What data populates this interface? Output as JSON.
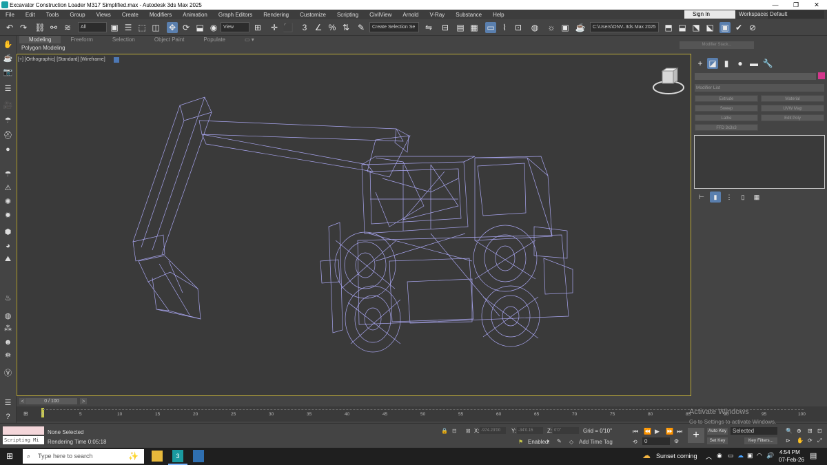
{
  "window": {
    "title": "Excavator Construction Loader M317 Simplified.max - Autodesk 3ds Max 2025",
    "min": "—",
    "max": "❐",
    "close": "✕"
  },
  "menus": [
    "File",
    "Edit",
    "Tools",
    "Group",
    "Views",
    "Create",
    "Modifiers",
    "Animation",
    "Graph Editors",
    "Rendering",
    "Customize",
    "Scripting",
    "CivilView",
    "Arnold",
    "V-Ray",
    "Substance",
    "Help"
  ],
  "account": {
    "signin": "Sign In",
    "workspaces_label": "Workspaces:",
    "workspace": "Default"
  },
  "toolbar": {
    "selection_filter": "All",
    "ref_coord": "View",
    "named_selection": "Create Selection Se",
    "project_path": "C:\\Users\\ONV..3ds Max 2025"
  },
  "ribbon": {
    "tabs": [
      "Modeling",
      "Freeform",
      "Selection",
      "Object Paint",
      "Populate"
    ],
    "active_tab": "Modeling",
    "panel_label": "Polygon Modeling"
  },
  "viewport": {
    "label": "[+] [Orthographic] [Standard] [Wireframe]",
    "viewcube_face": "LEFT"
  },
  "command_panel": {
    "modifier_list": "Modifier List",
    "buttons": [
      "Extrude",
      "Material",
      "Sweep",
      "UVW Map",
      "Lathe",
      "Edit Poly",
      "FFD 3x3x3"
    ],
    "tooltip_text": "Modifier Stack..."
  },
  "timeline": {
    "frame_range": "0 / 100",
    "ticks": [
      "0",
      "5",
      "10",
      "15",
      "20",
      "25",
      "30",
      "35",
      "40",
      "45",
      "50",
      "55",
      "60",
      "65",
      "70",
      "75",
      "80",
      "85",
      "90",
      "95",
      "100"
    ]
  },
  "status": {
    "listener": "Scripting Mi",
    "selection": "None Selected",
    "render_time": "Rendering Time  0:05:18",
    "x_label": "X:",
    "x": "-974.23'00",
    "y_label": "Y:",
    "y": "-34'0.15",
    "z_label": "Z:",
    "z": "0'0\"",
    "grid": "Grid = 0'10\"",
    "enabled": "Enabled:",
    "add_time_tag": "Add Time Tag",
    "auto_key": "Auto Key",
    "set_key": "Set Key",
    "selected": "Selected",
    "key_filters": "Key Filters...",
    "frame": "0"
  },
  "watermark": {
    "line1": "Activate Windows",
    "line2": "Go to Settings to activate Windows."
  },
  "taskbar": {
    "search_placeholder": "Type here to search",
    "weather": "Sunset coming",
    "time": "4:54 PM",
    "date": "07-Feb-26"
  }
}
